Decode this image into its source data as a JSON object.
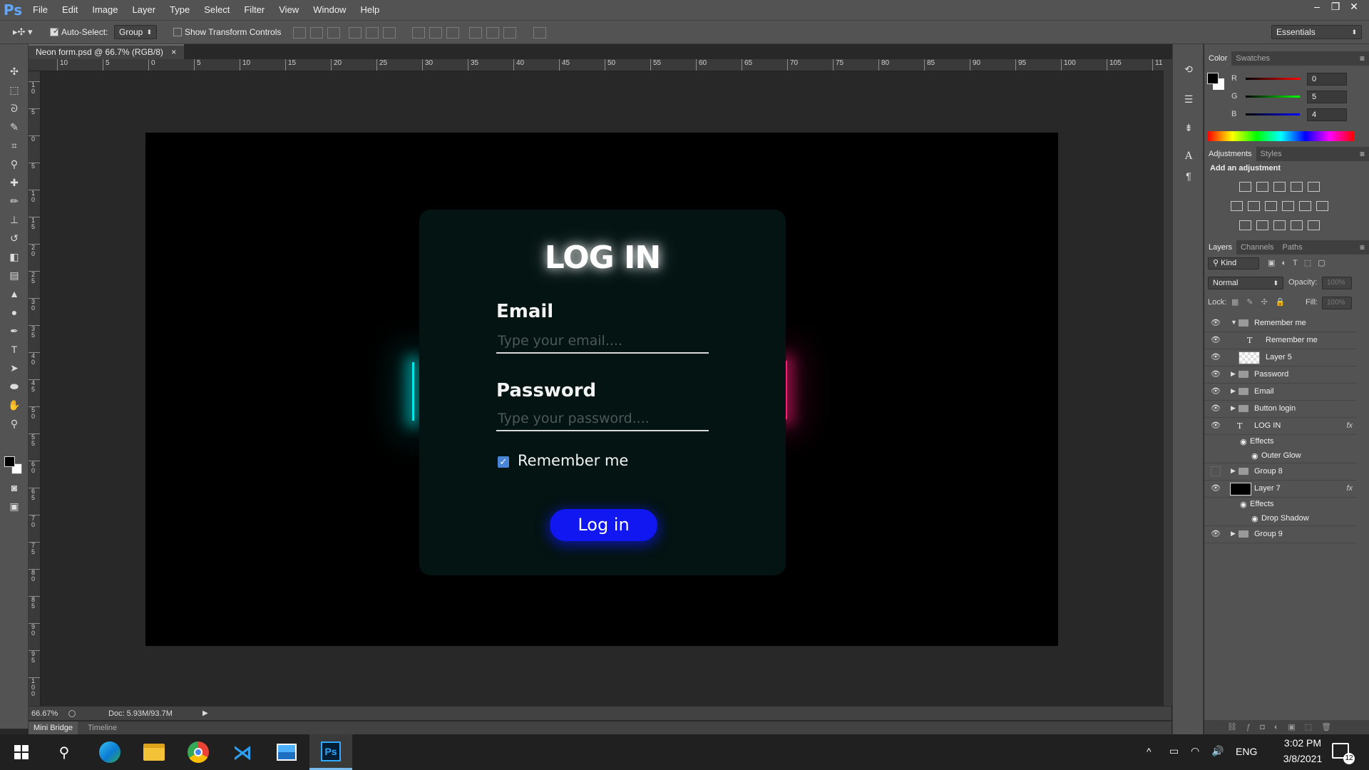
{
  "app": {
    "logo": "Ps",
    "title": "Adobe Photoshop"
  },
  "menubar": {
    "items": [
      "File",
      "Edit",
      "Image",
      "Layer",
      "Type",
      "Select",
      "Filter",
      "View",
      "Window",
      "Help"
    ]
  },
  "window_controls": {
    "minimize": "–",
    "restore": "❐",
    "close": "✕"
  },
  "options_bar": {
    "auto_select_label": "Auto-Select:",
    "auto_select_checked": true,
    "auto_select_value": "Group",
    "show_transform_label": "Show Transform Controls",
    "workspace": "Essentials"
  },
  "document": {
    "tab_title": "Neon form.psd @ 66.7% (RGB/8)",
    "tab_close": "×",
    "ruler_h_labels": [
      "10",
      "5",
      "0",
      "5",
      "10",
      "15",
      "20",
      "25",
      "30",
      "35",
      "40",
      "45",
      "50",
      "55",
      "60",
      "65",
      "70",
      "75",
      "80",
      "85",
      "90",
      "95",
      "100",
      "105",
      "11"
    ],
    "ruler_v_labels": [
      "1\n0",
      "5",
      "0",
      "5",
      "1\n0",
      "1\n5",
      "2\n0",
      "2\n5",
      "3\n0",
      "3\n5",
      "4\n0",
      "4\n5",
      "5\n0",
      "5\n5",
      "6\n0",
      "6\n5",
      "7\n0",
      "7\n5",
      "8\n0",
      "8\n5",
      "9\n0",
      "9\n5",
      "1\n0\n0"
    ]
  },
  "canvas": {
    "title": "LOG IN",
    "email_label": "Email",
    "email_placeholder": "Type your email....",
    "password_label": "Password",
    "password_placeholder": "Type your password....",
    "remember_label": "Remember me",
    "remember_checked": true,
    "button_label": "Log in",
    "colors": {
      "background": "#000000",
      "card": "#041413",
      "left_glow": "#00e5e5",
      "right_glow": "#ff1c79",
      "button": "#1017f1"
    }
  },
  "status": {
    "zoom": "66.67%",
    "doc": "Doc: 5.93M/93.7M"
  },
  "bottom_tabs": [
    "Mini Bridge",
    "Timeline"
  ],
  "color_panel": {
    "tabs": [
      "Color",
      "Swatches"
    ],
    "channels": [
      {
        "label": "R",
        "value": "0"
      },
      {
        "label": "G",
        "value": "5"
      },
      {
        "label": "B",
        "value": "4"
      }
    ]
  },
  "adjustments_panel": {
    "tabs": [
      "Adjustments",
      "Styles"
    ],
    "heading": "Add an adjustment"
  },
  "layers_panel": {
    "tabs": [
      "Layers",
      "Channels",
      "Paths"
    ],
    "kind": "Kind",
    "blend_mode": "Normal",
    "opacity_label": "Opacity:",
    "opacity_value": "100%",
    "lock_label": "Lock:",
    "fill_label": "Fill:",
    "fill_value": "100%",
    "layers": [
      {
        "name": "Remember me",
        "kind": "group-open"
      },
      {
        "name": "Remember me",
        "kind": "text"
      },
      {
        "name": "Layer 5",
        "kind": "pixel"
      },
      {
        "name": "Password",
        "kind": "group"
      },
      {
        "name": "Email",
        "kind": "group"
      },
      {
        "name": "Button login",
        "kind": "group"
      },
      {
        "name": "LOG IN",
        "kind": "text",
        "fx": true
      },
      {
        "name": "Effects",
        "kind": "effects"
      },
      {
        "name": "Outer Glow",
        "kind": "effect"
      },
      {
        "name": "Group 8",
        "kind": "group",
        "hidden": true
      },
      {
        "name": "Layer 7",
        "kind": "pixel",
        "fx": true
      },
      {
        "name": "Effects",
        "kind": "effects"
      },
      {
        "name": "Drop Shadow",
        "kind": "effect"
      },
      {
        "name": "Group 9",
        "kind": "group"
      }
    ]
  },
  "taskbar": {
    "apps": [
      "start",
      "search",
      "edge",
      "file-explorer",
      "chrome",
      "vscode",
      "photos",
      "photoshop"
    ],
    "tray": {
      "language": "ENG",
      "time": "3:02 PM",
      "date": "3/8/2021",
      "notifications": "12"
    }
  }
}
